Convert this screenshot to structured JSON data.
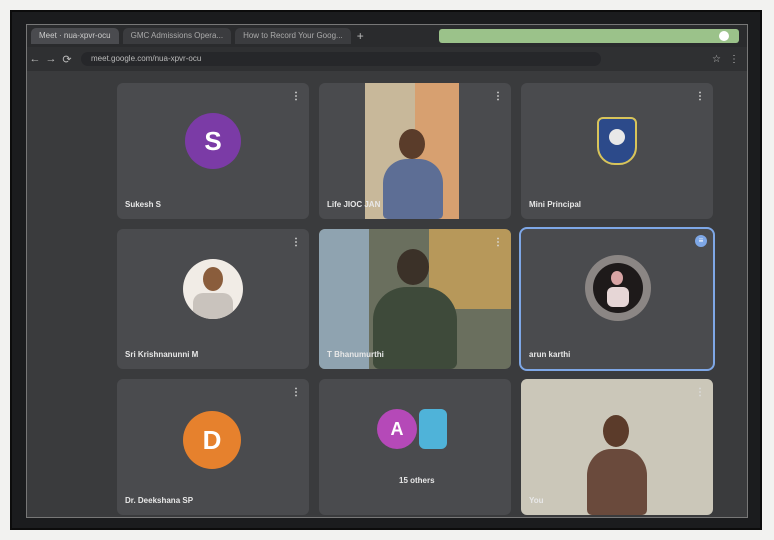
{
  "browser": {
    "tabs": [
      {
        "label": "Meet · nua-xpvr-ocu"
      },
      {
        "label": "GMC Admissions Opera..."
      },
      {
        "label": "How to Record Your Goog..."
      }
    ],
    "new_tab": "+",
    "url": "meet.google.com/nua-xpvr-ocu",
    "nav": {
      "back": "←",
      "forward": "→",
      "reload": "⟳",
      "lock": "🔒"
    },
    "toolbar": {
      "star": "☆",
      "menu": "⋮"
    }
  },
  "participants": [
    {
      "name": "Sukesh S",
      "type": "avatar",
      "initial": "S",
      "avatar_color": "#7b3ba6"
    },
    {
      "name": "Life JIOC JAN",
      "type": "video"
    },
    {
      "name": "Mini Principal",
      "type": "logo"
    },
    {
      "name": "Sri Krishnanunni M",
      "type": "photo"
    },
    {
      "name": "T Bhanumurthi",
      "type": "video"
    },
    {
      "name": "arun karthi",
      "type": "photo-round",
      "active_speaker": true
    },
    {
      "name": "Dr. Deekshana SP",
      "type": "avatar",
      "initial": "D",
      "avatar_color": "#e6812d"
    },
    {
      "name": "15 others",
      "type": "group",
      "initial": "A",
      "avatar_color": "#b549b8"
    },
    {
      "name": "You",
      "type": "video"
    }
  ],
  "tile_menu_glyph": "⋮",
  "speaking_glyph": "≡"
}
